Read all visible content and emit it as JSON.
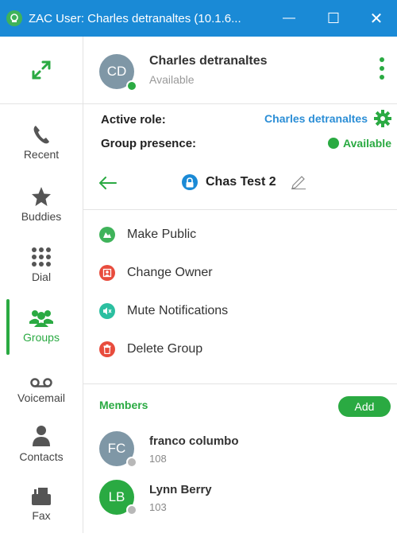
{
  "window": {
    "title": "ZAC User: Charles detranaltes (10.1.6...",
    "minimize_glyph": "—",
    "maximize_glyph": "☐",
    "close_glyph": "✕"
  },
  "sidebar": {
    "items": [
      {
        "label": "Recent",
        "icon": "phone-icon"
      },
      {
        "label": "Buddies",
        "icon": "star-icon"
      },
      {
        "label": "Dial",
        "icon": "dialpad-icon"
      },
      {
        "label": "Groups",
        "icon": "groups-icon",
        "active": true
      },
      {
        "label": "Voicemail",
        "icon": "voicemail-icon"
      },
      {
        "label": "Contacts",
        "icon": "contact-icon"
      },
      {
        "label": "Fax",
        "icon": "fax-icon"
      }
    ]
  },
  "user": {
    "initials": "CD",
    "name": "Charles detranaltes",
    "status": "Available"
  },
  "role": {
    "active_role_label": "Active role:",
    "active_role_value": "Charles detranaltes",
    "group_presence_label": "Group presence:",
    "group_presence_value": "Available"
  },
  "group": {
    "name": "Chas Test 2"
  },
  "actions": [
    {
      "label": "Make Public",
      "icon": "public-icon",
      "color": "#3fb35a"
    },
    {
      "label": "Change Owner",
      "icon": "change-owner-icon",
      "color": "#e84c3d"
    },
    {
      "label": "Mute Notifications",
      "icon": "mute-icon",
      "color": "#2bbfa0"
    },
    {
      "label": "Delete Group",
      "icon": "trash-icon",
      "color": "#e84c3d"
    }
  ],
  "members": {
    "title": "Members",
    "add_label": "Add",
    "list": [
      {
        "initials": "FC",
        "name": "franco columbo",
        "ext": "108",
        "avatar_color": "#7f97a6"
      },
      {
        "initials": "LB",
        "name": "Lynn Berry",
        "ext": "103",
        "avatar_color": "#2aaa42"
      }
    ]
  },
  "colors": {
    "titlebar": "#1a8ad6",
    "accent_green": "#2aaa42",
    "link_blue": "#2b8ed6"
  }
}
